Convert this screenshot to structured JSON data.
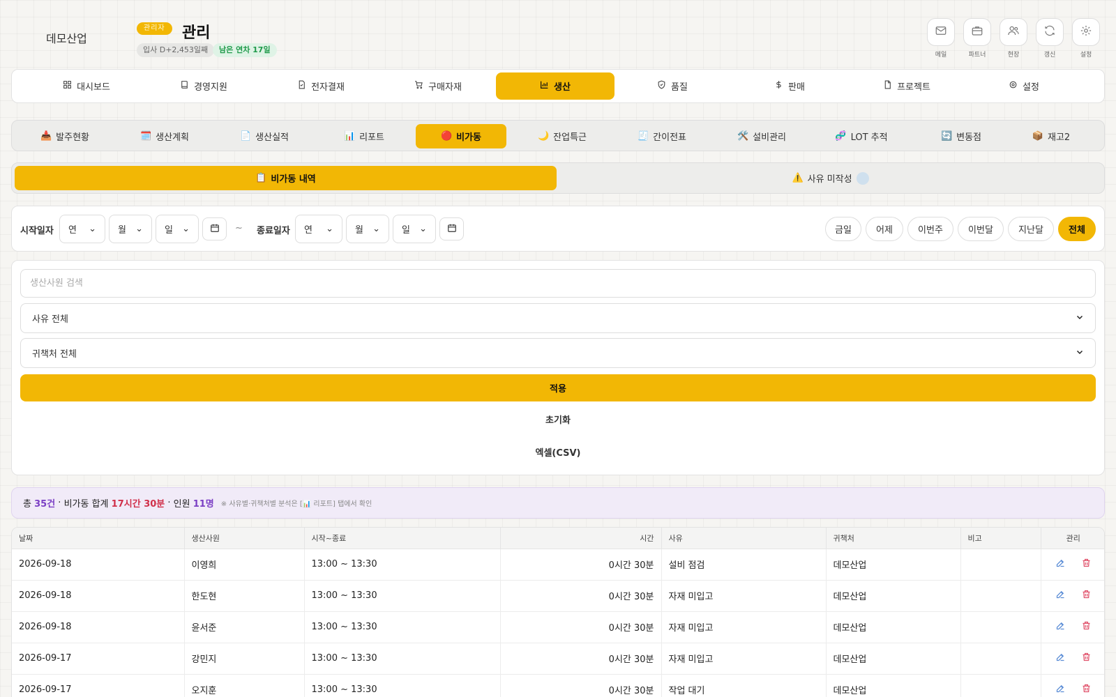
{
  "header": {
    "company": "데모산업",
    "role_badge": "관리자",
    "user_name": "관리",
    "join_chip": "입사 D+2,453일째",
    "leave_chip": "남은 연차 17일",
    "icons": [
      {
        "label": "메일",
        "icon": "mail-icon"
      },
      {
        "label": "파트너",
        "icon": "briefcase-icon"
      },
      {
        "label": "현장",
        "icon": "users-icon"
      },
      {
        "label": "갱신",
        "icon": "refresh-icon"
      },
      {
        "label": "설정",
        "icon": "gear-icon"
      }
    ]
  },
  "main_nav": [
    {
      "label": "대시보드",
      "icon": "grid-icon"
    },
    {
      "label": "경영지원",
      "icon": "book-icon"
    },
    {
      "label": "전자결재",
      "icon": "document-icon"
    },
    {
      "label": "구매자재",
      "icon": "cart-icon"
    },
    {
      "label": "생산",
      "icon": "chart-icon",
      "active": true
    },
    {
      "label": "품질",
      "icon": "shield-icon"
    },
    {
      "label": "판매",
      "icon": "dollar-icon"
    },
    {
      "label": "프로젝트",
      "icon": "file-icon"
    },
    {
      "label": "설정",
      "icon": "gear-icon"
    }
  ],
  "sub_tabs": [
    {
      "label": "발주현황",
      "emoji": "📥"
    },
    {
      "label": "생산계획",
      "emoji": "🗓️"
    },
    {
      "label": "생산실적",
      "emoji": "📄"
    },
    {
      "label": "리포트",
      "emoji": "📊"
    },
    {
      "label": "비가동",
      "emoji": "🔴",
      "active": true
    },
    {
      "label": "잔업특근",
      "emoji": "🌙"
    },
    {
      "label": "간이전표",
      "emoji": "🧾"
    },
    {
      "label": "설비관리",
      "emoji": "🛠️"
    },
    {
      "label": "LOT 추적",
      "emoji": "🧬"
    },
    {
      "label": "변동점",
      "emoji": "🔄"
    },
    {
      "label": "재고2",
      "emoji": "📦"
    }
  ],
  "view_tabs": [
    {
      "label": "비가동 내역",
      "emoji": "📋",
      "active": true
    },
    {
      "label": "사유 미작성",
      "emoji": "⚠️"
    }
  ],
  "date_filter": {
    "start_label": "시작일자",
    "end_label": "종료일자",
    "year_placeholder": "연",
    "month_placeholder": "월",
    "day_placeholder": "일",
    "tilde": "~",
    "quick": [
      "금일",
      "어제",
      "이번주",
      "이번달",
      "지난달",
      "전체"
    ],
    "quick_active": "전체"
  },
  "search": {
    "placeholder": "생산사원 검색",
    "reason_select": "사유 전체",
    "owner_select": "귀책처 전체",
    "apply": "적용",
    "reset": "초기화",
    "excel": "엑셀(CSV)"
  },
  "summary": {
    "total_prefix": "총",
    "count": "35건",
    "sum_label": "비가동 합계",
    "sum_value": "17시간 30분",
    "people_label": "인원",
    "people_value": "11명",
    "note": "※ 사유별·귀책처별 분석은 [📊 리포트] 탭에서 확인"
  },
  "table": {
    "headers": [
      "날짜",
      "생산사원",
      "시작~종료",
      "시간",
      "사유",
      "귀책처",
      "비고",
      "관리"
    ],
    "rows": [
      {
        "date": "2026-09-18",
        "worker": "이영희",
        "range": "13:00 ~ 13:30",
        "duration": "0시간 30분",
        "reason": "설비 점검",
        "owner": "데모산업",
        "note": ""
      },
      {
        "date": "2026-09-18",
        "worker": "한도현",
        "range": "13:00 ~ 13:30",
        "duration": "0시간 30분",
        "reason": "자재 미입고",
        "owner": "데모산업",
        "note": ""
      },
      {
        "date": "2026-09-18",
        "worker": "윤서준",
        "range": "13:00 ~ 13:30",
        "duration": "0시간 30분",
        "reason": "자재 미입고",
        "owner": "데모산업",
        "note": ""
      },
      {
        "date": "2026-09-17",
        "worker": "강민지",
        "range": "13:00 ~ 13:30",
        "duration": "0시간 30분",
        "reason": "자재 미입고",
        "owner": "데모산업",
        "note": ""
      },
      {
        "date": "2026-09-17",
        "worker": "오지훈",
        "range": "13:00 ~ 13:30",
        "duration": "0시간 30분",
        "reason": "작업 대기",
        "owner": "데모산업",
        "note": ""
      }
    ]
  },
  "colors": {
    "accent": "#f2b705",
    "purple": "#7b3fc4",
    "red": "#d0304a",
    "edit": "#5b8dd6",
    "delete": "#e0506a"
  }
}
